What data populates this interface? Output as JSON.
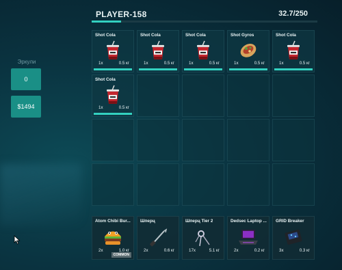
{
  "header": {
    "player_name": "PLAYER-158",
    "weight": "32.7/250",
    "weight_fraction": 0.131
  },
  "sidebar": {
    "label": "Эркули",
    "currency_a": "0",
    "currency_b": "$1494"
  },
  "inventory": [
    {
      "name": "Shot Cola",
      "qty": "1x",
      "weight": "0.5 кг",
      "icon": "cola-cup-icon"
    },
    {
      "name": "Shot Cola",
      "qty": "1x",
      "weight": "0.5 кг",
      "icon": "cola-cup-icon"
    },
    {
      "name": "Shot Cola",
      "qty": "1x",
      "weight": "0.5 кг",
      "icon": "cola-cup-icon"
    },
    {
      "name": "Shot Gyros",
      "qty": "1x",
      "weight": "0.5 кг",
      "icon": "gyros-icon"
    },
    {
      "name": "Shot Cola",
      "qty": "1x",
      "weight": "0.5 кг",
      "icon": "cola-cup-icon"
    },
    {
      "name": "Shot Cola",
      "qty": "1x",
      "weight": "0.5 кг",
      "icon": "cola-cup-icon"
    }
  ],
  "hotbar": [
    {
      "name": "Atom Chibi Bur...",
      "qty": "2x",
      "weight": "1.0 кг",
      "badge": "COMMON",
      "icon": "burger-icon"
    },
    {
      "name": "Шперц",
      "qty": "2x",
      "weight": "0.6 кг",
      "icon": "lockpick-icon"
    },
    {
      "name": "Шперц Tier 2",
      "qty": "17x",
      "weight": "5.1 кг",
      "icon": "lockpick-tier2-icon"
    },
    {
      "name": "Dedsec Laptop ...",
      "qty": "2x",
      "weight": "0.2 кг",
      "icon": "laptop-icon"
    },
    {
      "name": "GRID Breaker",
      "qty": "3x",
      "weight": "0.3 кг",
      "icon": "grid-breaker-icon"
    }
  ]
}
